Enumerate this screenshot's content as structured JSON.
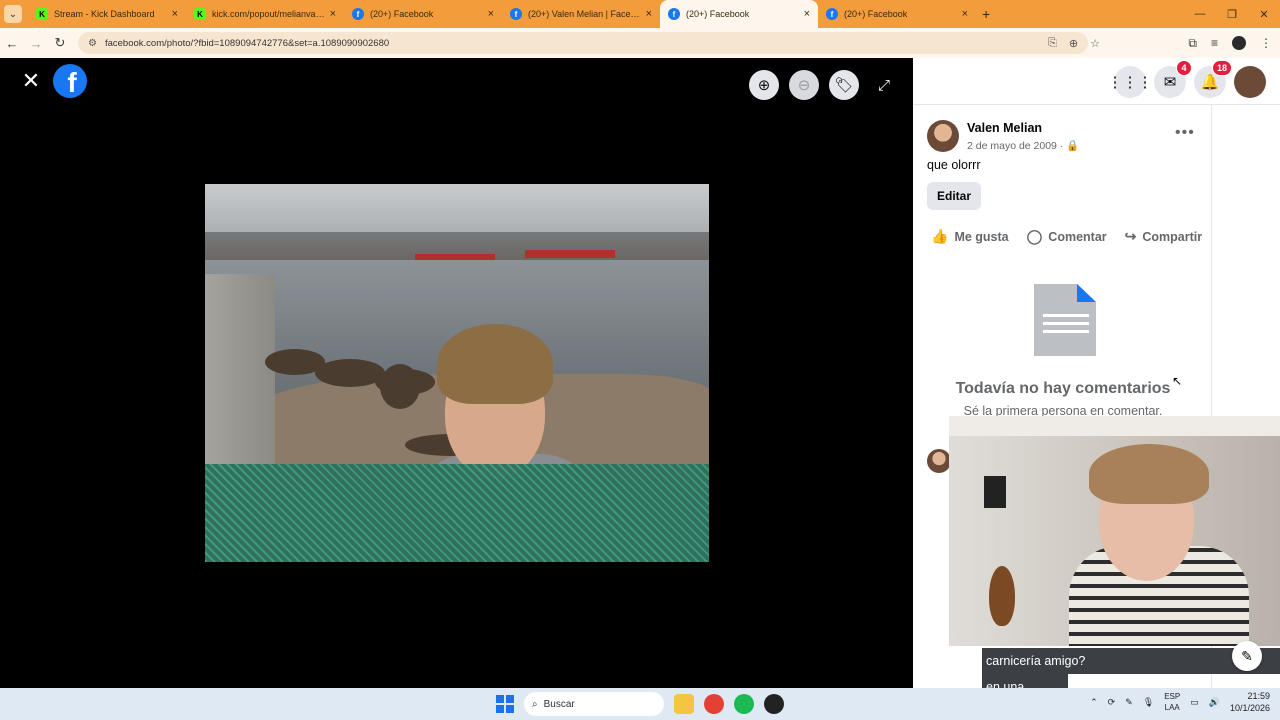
{
  "browser": {
    "tabs": [
      {
        "title": "Stream - Kick Dashboard",
        "icon": "kick-icon",
        "active": false
      },
      {
        "title": "kick.com/popout/melianvalen/",
        "icon": "kick-icon",
        "active": false
      },
      {
        "title": "(20+) Facebook",
        "icon": "facebook-icon",
        "active": false
      },
      {
        "title": "(20+) Valen Melian | Facebook",
        "icon": "facebook-icon",
        "active": false
      },
      {
        "title": "(20+) Facebook",
        "icon": "facebook-icon",
        "active": true
      },
      {
        "title": "(20+) Facebook",
        "icon": "facebook-icon",
        "active": false
      }
    ],
    "url": "facebook.com/photo/?fbid=1089094742776&set=a.1089090902680",
    "new_tab": "+",
    "close_glyph": "×"
  },
  "viewer": {
    "logo_letter": "f",
    "tools": [
      "zoom-in-icon",
      "zoom-out-icon",
      "tag-icon",
      "fullscreen-icon"
    ]
  },
  "panel": {
    "messenger_badge": "4",
    "notifications_badge": "18",
    "author": "Valen Melian",
    "date": "2 de mayo de 2009 · ",
    "privacy_icon": "lock-icon",
    "caption": "que olorrr",
    "edit_label": "Editar",
    "like_label": "Me gusta",
    "comment_label": "Comentar",
    "share_label": "Compartir",
    "empty_title": "Todavía no hay comentarios",
    "empty_subtitle": "Sé la primera persona en comentar."
  },
  "chat_overlay": {
    "line1": "carnicería amigo?",
    "line2": "en una"
  },
  "taskbar": {
    "search_placeholder": "Buscar",
    "lang_top": "ESP",
    "lang_bottom": "LAA",
    "time": "21:59",
    "date": "10/1/2026"
  },
  "colors": {
    "accent": "#1877f2",
    "tab_bar": "#f39c3c",
    "badge": "#e41e3f"
  }
}
